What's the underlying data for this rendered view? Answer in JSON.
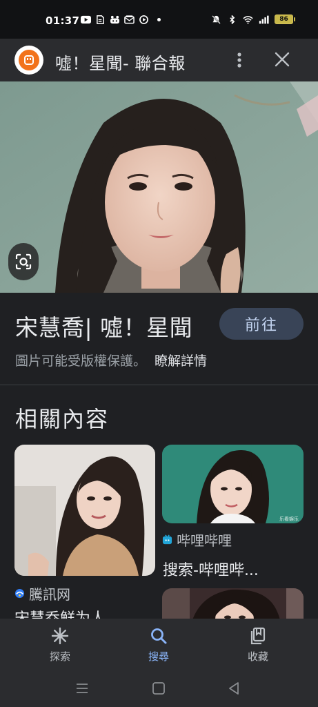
{
  "status_bar": {
    "time": "01:37",
    "battery": "86",
    "left_icons": [
      "youtube-icon",
      "document-icon",
      "game-icon",
      "mail-icon",
      "play-icon",
      "dot-icon"
    ],
    "right_icons": [
      "mute-icon",
      "bluetooth-icon",
      "wifi-icon",
      "signal-icon",
      "battery-icon"
    ]
  },
  "header": {
    "site_title": "噓！星聞- 聯合報",
    "logo_icon": "udn-logo-icon",
    "more_icon": "more-vert-icon",
    "close_icon": "close-icon"
  },
  "hero": {
    "lens_icon": "lens-icon"
  },
  "result": {
    "title": "宋慧喬| 噓！星聞",
    "visit_label": "前往",
    "copyright_text": "圖片可能受版權保護。",
    "learn_more": "瞭解詳情"
  },
  "related": {
    "heading": "相關內容",
    "items": [
      {
        "source": "騰訊网",
        "caption": "宋慧乔鲜为人",
        "source_color": "#2f7cf6"
      },
      {
        "source": "哔哩哔哩",
        "caption": "搜索-哔哩哔...",
        "source_color": "#21a5d8"
      },
      {
        "source": "",
        "caption": "",
        "source_color": ""
      }
    ],
    "badge_text": "乐看娱乐"
  },
  "bottom_nav": {
    "items": [
      {
        "label": "探索",
        "icon": "asterisk-icon",
        "active": false
      },
      {
        "label": "搜尋",
        "icon": "search-icon",
        "active": true
      },
      {
        "label": "收藏",
        "icon": "collections-icon",
        "active": false
      }
    ]
  },
  "system_nav": {
    "icons": [
      "menu-icon",
      "home-icon",
      "back-icon"
    ]
  },
  "colors": {
    "background": "#1f2023",
    "header": "#2b2c2f",
    "accent": "#8ab4f8",
    "button": "#394457",
    "logo_orange": "#f2731c"
  }
}
